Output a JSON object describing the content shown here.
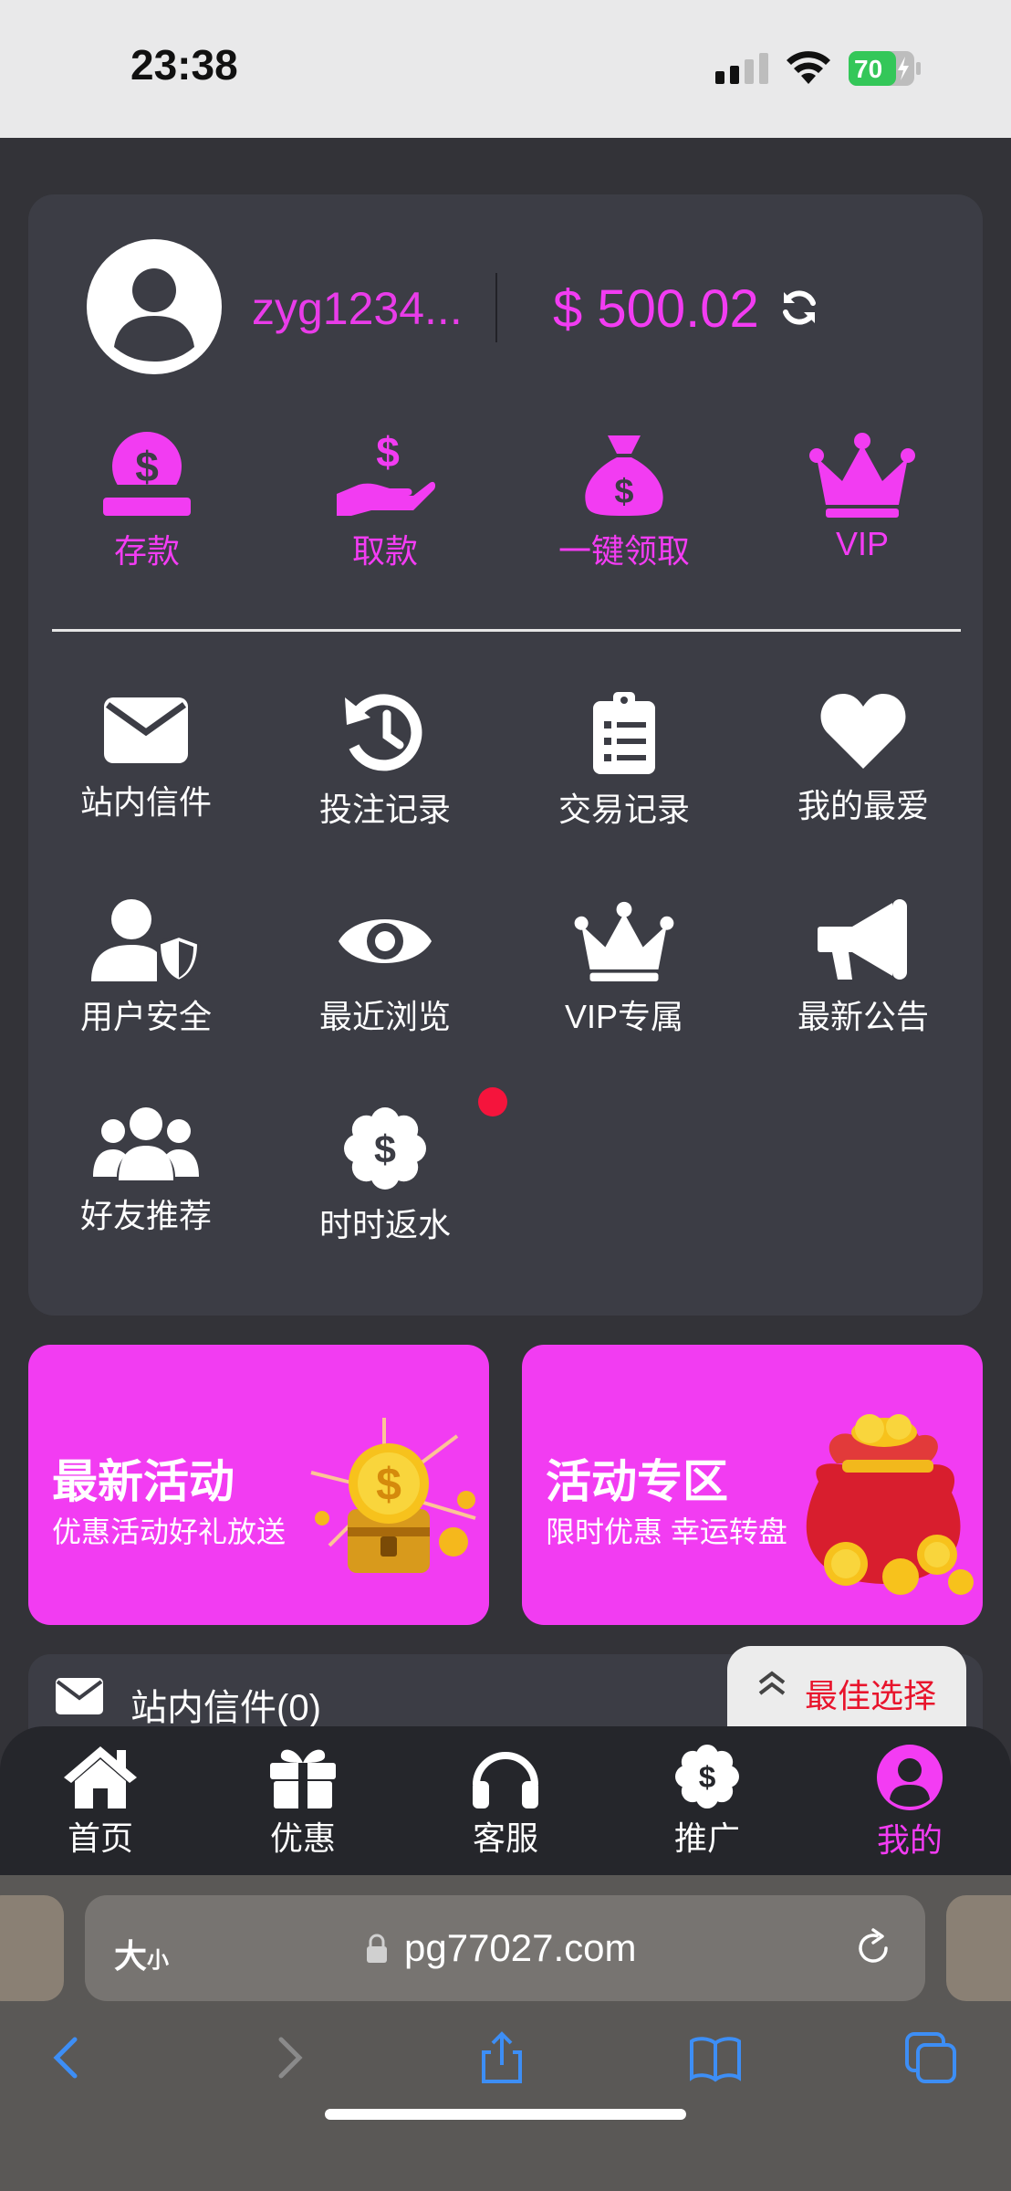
{
  "status_bar": {
    "time": "23:38",
    "battery": "70"
  },
  "profile": {
    "username": "zyg1234...",
    "balance": "$ 500.02"
  },
  "quick_actions": [
    {
      "label": "存款",
      "icon": "deposit-icon"
    },
    {
      "label": "取款",
      "icon": "withdraw-icon"
    },
    {
      "label": "一键领取",
      "icon": "money-bag-icon"
    },
    {
      "label": "VIP",
      "icon": "crown-icon"
    }
  ],
  "menu_grid": [
    {
      "label": "站内信件",
      "icon": "envelope-icon"
    },
    {
      "label": "投注记录",
      "icon": "history-icon"
    },
    {
      "label": "交易记录",
      "icon": "clipboard-icon"
    },
    {
      "label": "我的最爱",
      "icon": "heart-icon"
    },
    {
      "label": "用户安全",
      "icon": "user-shield-icon"
    },
    {
      "label": "最近浏览",
      "icon": "eye-icon"
    },
    {
      "label": "VIP专属",
      "icon": "crown-icon"
    },
    {
      "label": "最新公告",
      "icon": "megaphone-icon"
    },
    {
      "label": "好友推荐",
      "icon": "users-icon"
    },
    {
      "label": "时时返水",
      "icon": "dollar-badge-icon"
    }
  ],
  "banners": [
    {
      "title": "最新活动",
      "subtitle": "优惠活动好礼放送"
    },
    {
      "title": "活动专区",
      "subtitle": "限时优惠 幸运转盘"
    }
  ],
  "mail_bar": {
    "text": "站内信件(0)"
  },
  "best_choice": {
    "label": "最佳选择"
  },
  "bottom_nav": [
    {
      "label": "首页",
      "icon": "home-icon"
    },
    {
      "label": "优惠",
      "icon": "gift-icon"
    },
    {
      "label": "客服",
      "icon": "headset-icon"
    },
    {
      "label": "推广",
      "icon": "dollar-badge-icon"
    },
    {
      "label": "我的",
      "icon": "user-circle-icon",
      "active": true
    }
  ],
  "browser": {
    "text_size_big": "大",
    "text_size_small": "小",
    "url": "pg77027.com"
  },
  "colors": {
    "accent": "#f23cf2",
    "card": "#3c3d45",
    "background": "#333338",
    "nav": "#25262b",
    "alert": "#f5143c"
  }
}
